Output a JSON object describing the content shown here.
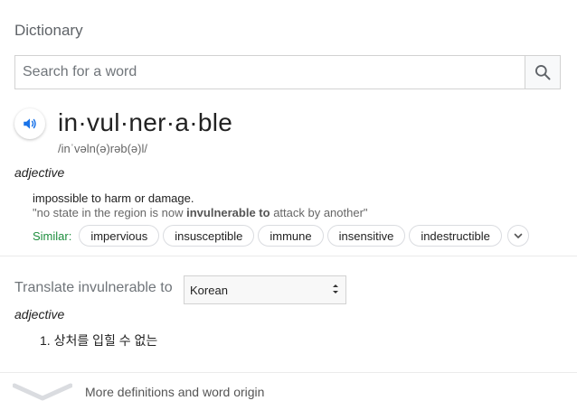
{
  "header": {
    "title": "Dictionary"
  },
  "search": {
    "placeholder": "Search for a word",
    "value": ""
  },
  "entry": {
    "headword": "in·vul·ner·a·ble",
    "pronunciation": "/inˈvəln(ə)rəb(ə)l/",
    "part_of_speech": "adjective",
    "definition": "impossible to harm or damage.",
    "example": {
      "before": "\"no state in the region is now ",
      "bold": "invulnerable to",
      "after": " attack by another\""
    },
    "similar_label": "Similar:",
    "similar": [
      "impervious",
      "insusceptible",
      "immune",
      "insensitive",
      "indestructible"
    ]
  },
  "translate": {
    "label": "Translate invulnerable to",
    "selected_language": "Korean",
    "part_of_speech": "adjective",
    "translation": "1. 상처를 입힐 수 없는"
  },
  "footer": {
    "more_label": "More definitions and word origin"
  },
  "icons": {
    "search": "search-icon",
    "speaker": "speaker-icon",
    "expand": "chevron-down-icon"
  },
  "colors": {
    "accent": "#1a73e8",
    "similar_label": "#1e8e3e"
  }
}
